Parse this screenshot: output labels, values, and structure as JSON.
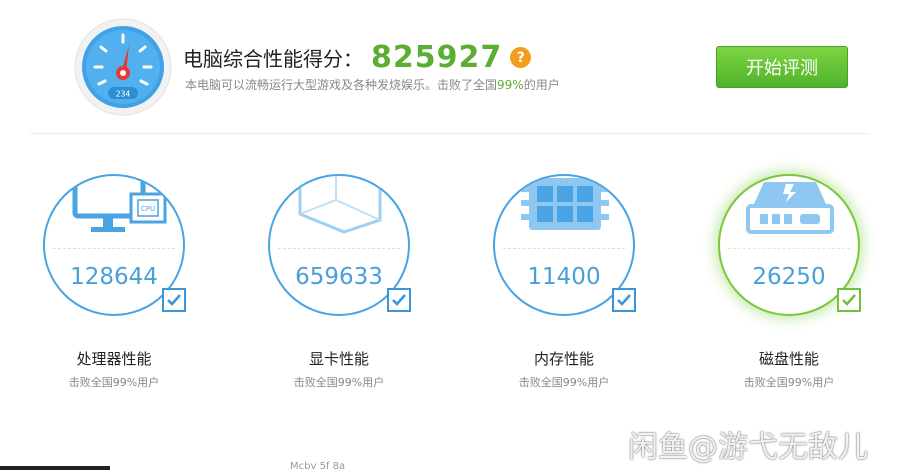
{
  "header": {
    "score_label": "电脑综合性能得分：",
    "score_value": "825927",
    "help_icon": "question-icon",
    "desc_prefix": "本电脑可以流畅运行大型游戏及各种发烧娱乐。击败了全国",
    "desc_percent": "99%",
    "desc_suffix": "的用户",
    "start_button": "开始评测",
    "gauge_readout": "234"
  },
  "colors": {
    "accent_blue": "#4aa3e3",
    "accent_green": "#5cae32",
    "help_orange": "#f29e1d",
    "button_green": "#4fb22b"
  },
  "cards": [
    {
      "icon": "cpu-monitor-icon",
      "value": "128644",
      "title": "处理器性能",
      "subtitle": "击败全国99%用户",
      "status": "checked"
    },
    {
      "icon": "graphics-card-icon",
      "value": "659633",
      "title": "显卡性能",
      "subtitle": "击败全国99%用户",
      "status": "checked"
    },
    {
      "icon": "memory-chip-icon",
      "value": "11400",
      "title": "内存性能",
      "subtitle": "击败全国99%用户",
      "status": "checked"
    },
    {
      "icon": "hard-disk-icon",
      "value": "26250",
      "title": "磁盘性能",
      "subtitle": "击败全国99%用户",
      "status": "checked"
    }
  ],
  "watermark": "闲鱼@游弋无敌儿",
  "cut_text": "Mcbv 5f 8a"
}
